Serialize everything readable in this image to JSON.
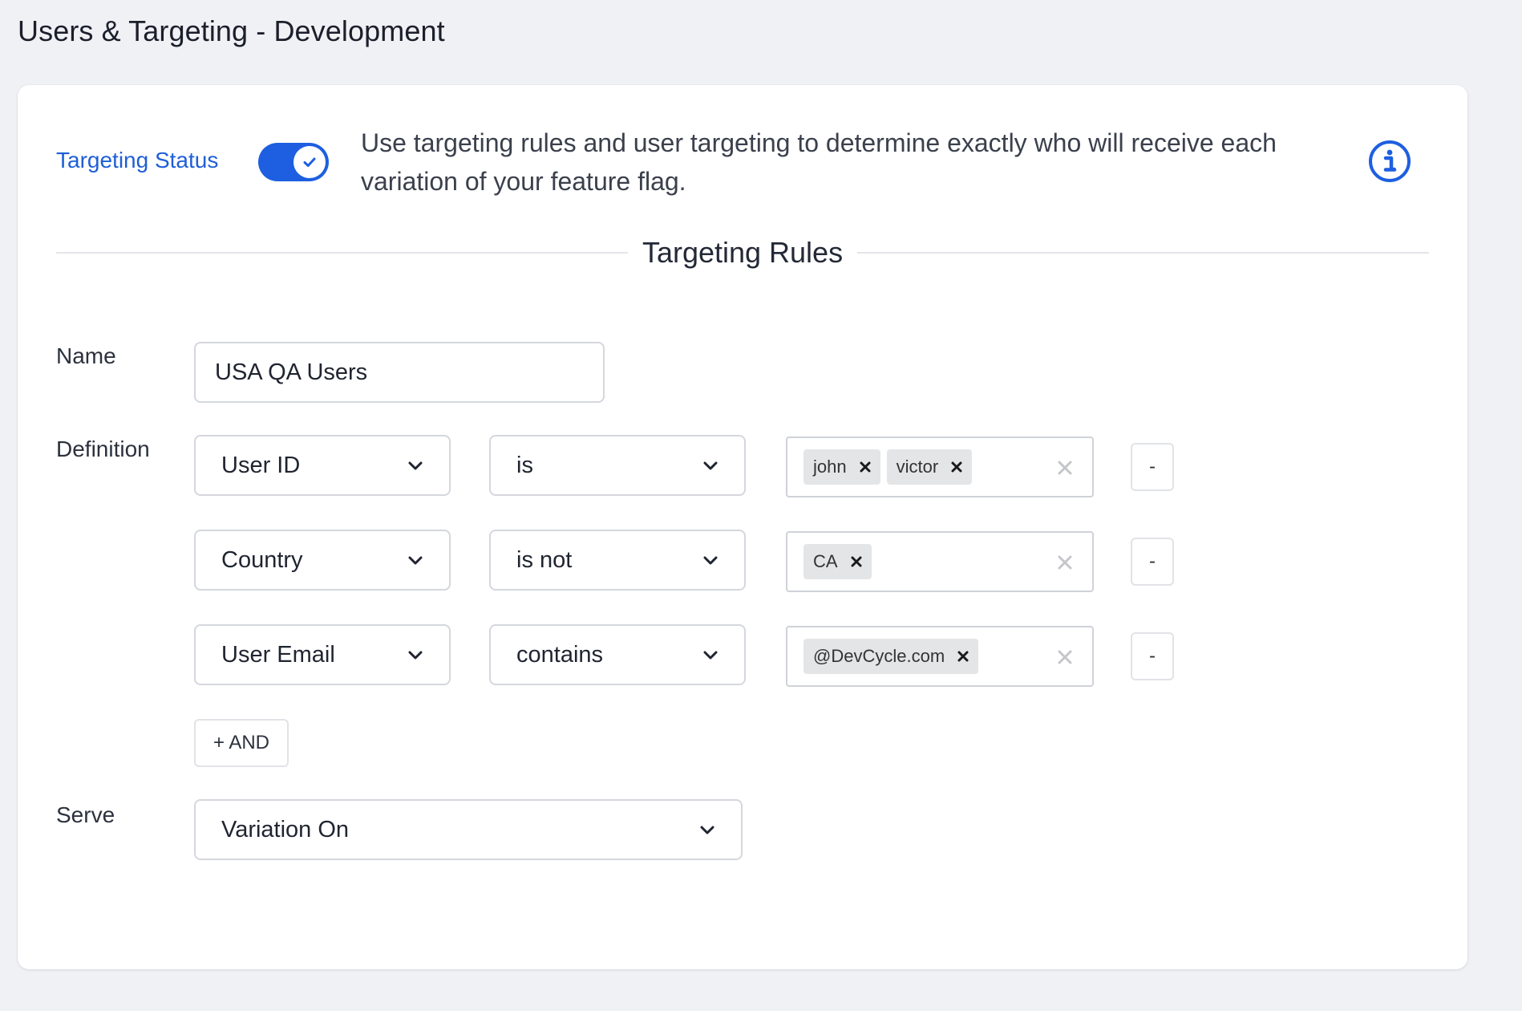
{
  "page": {
    "title": "Users & Targeting - Development"
  },
  "targeting": {
    "status_label": "Targeting Status",
    "status_on": true,
    "description": "Use targeting rules and user targeting to determine exactly who will receive each variation of your feature flag."
  },
  "rules": {
    "section_title": "Targeting Rules",
    "name_label": "Name",
    "name_value": "USA QA Users",
    "definition_label": "Definition",
    "definitions": [
      {
        "property": "User ID",
        "operator": "is",
        "values": [
          "john",
          "victor"
        ]
      },
      {
        "property": "Country",
        "operator": "is not",
        "values": [
          "CA"
        ]
      },
      {
        "property": "User Email",
        "operator": "contains",
        "values": [
          "@DevCycle.com"
        ]
      }
    ],
    "remove_label": "-",
    "and_label": "+ AND",
    "serve_label": "Serve",
    "serve_value": "Variation On"
  },
  "icons": {
    "toggle": "check-icon",
    "info": "info-icon",
    "chevron": "chevron-down-icon",
    "tag_remove": "close-icon",
    "clear": "close-icon"
  },
  "colors": {
    "accent": "#1d5fe0",
    "status_label": "#1f5fd6",
    "background": "#f0f1f5"
  }
}
